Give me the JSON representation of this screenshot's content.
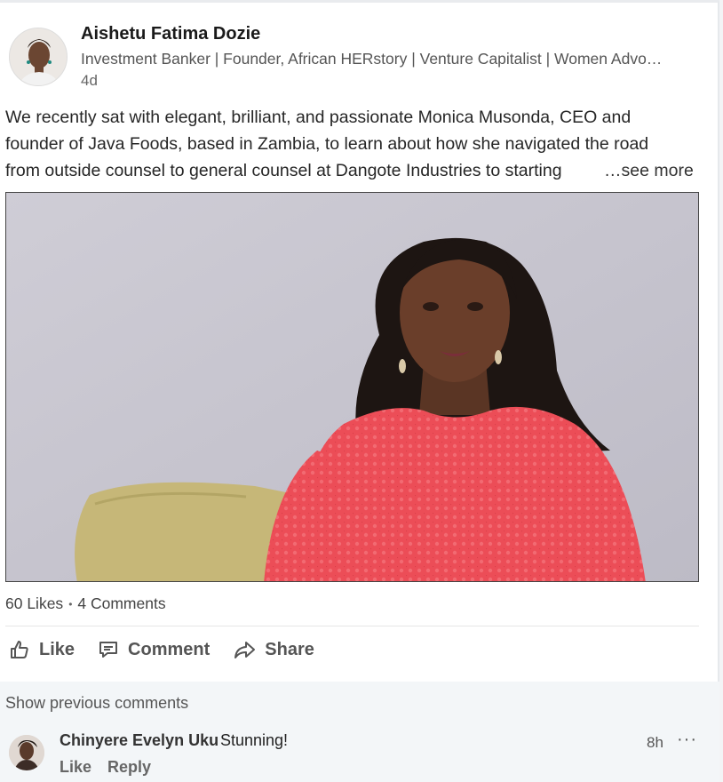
{
  "post": {
    "author_name": "Aishetu Fatima Dozie",
    "author_headline": "Investment Banker | Founder, African HERstory | Venture Capitalist | Women Advo…",
    "time": "4d",
    "text_lines": [
      "We recently sat with elegant, brilliant, and passionate Monica Musonda, CEO and",
      "founder of Java Foods, based in Zambia, to learn about how she navigated the road",
      "from outside counsel to general counsel at Dangote Industries to starting"
    ],
    "see_more": "…see more",
    "video_alt": "Woman in red lace dress speaking on interview",
    "likes": "60 Likes",
    "separator": "•",
    "comments_count": "4 Comments"
  },
  "actions": {
    "like": "Like",
    "comment": "Comment",
    "share": "Share"
  },
  "comments": {
    "show_previous": "Show previous comments",
    "items": [
      {
        "author": "Chinyere Evelyn Uku",
        "text": "Stunning!",
        "time": "8h",
        "more": "···",
        "like": "Like",
        "reply": "Reply"
      }
    ]
  },
  "icons": {
    "like": "thumbs-up-icon",
    "comment": "comment-icon",
    "share": "share-arrow-icon",
    "more": "ellipsis-icon"
  }
}
